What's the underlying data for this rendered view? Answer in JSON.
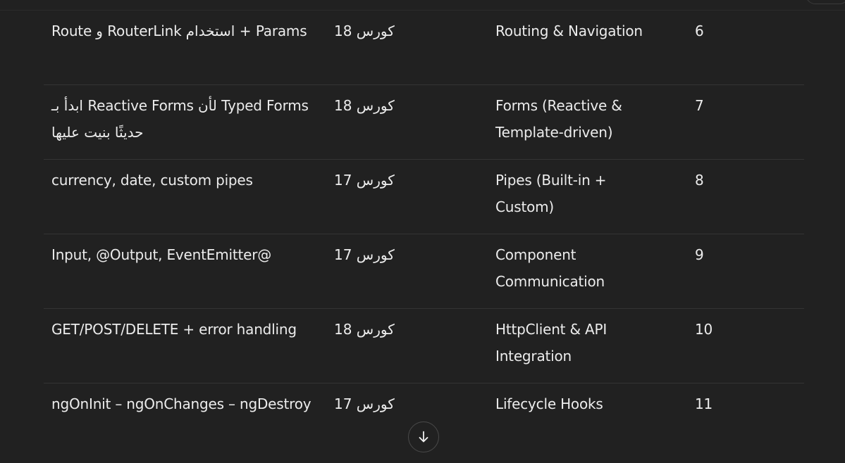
{
  "rows": [
    {
      "notes": "Route و RouterLink استخدام + Params",
      "course": "كورس 18",
      "topic": "Routing & Navigation",
      "num": "6"
    },
    {
      "notes": "ابدأ بـ Reactive Forms لأن Typed Forms حديثًا بنيت عليها",
      "course": "كورس 18",
      "topic": "Forms (Reactive & Template-driven)",
      "num": "7"
    },
    {
      "notes": "currency, date, custom pipes",
      "course": "كورس 17",
      "topic": "Pipes (Built-in + Custom)",
      "num": "8"
    },
    {
      "notes": "Input, @Output, EventEmitter@",
      "course": "كورس 17",
      "topic": "Component Communication",
      "num": "9"
    },
    {
      "notes": "GET/POST/DELETE + error handling",
      "course": "كورس 18",
      "topic": "HttpClient & API Integration",
      "num": "10"
    },
    {
      "notes": "ngOnInit – ngOnChanges – ngDestroy",
      "course": "كورس 17",
      "topic": "Lifecycle Hooks",
      "num": "11"
    }
  ],
  "icons": {
    "scroll_down": "arrow-down-icon"
  },
  "colors": {
    "background": "#212121",
    "text": "#ececec",
    "divider": "#343434"
  }
}
